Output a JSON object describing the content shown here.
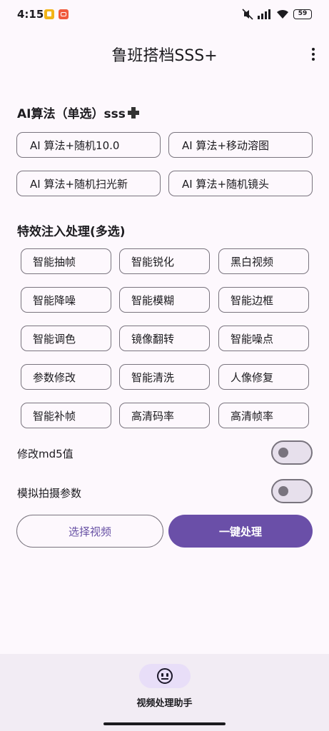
{
  "status": {
    "time": "4:15",
    "battery": "59"
  },
  "app": {
    "title": "鲁班搭档SSS+"
  },
  "algo": {
    "title": "AI算法（单选）sss",
    "items": [
      "AI 算法+随机10.0",
      "AI 算法+移动溶图",
      "AI 算法+随机扫光新",
      "AI 算法+随机镜头"
    ]
  },
  "effects": {
    "title": "特效注入处理(多选)",
    "items": [
      "智能抽帧",
      "智能锐化",
      "黑白视频",
      "智能降噪",
      "智能模糊",
      "智能边框",
      "智能调色",
      "镜像翻转",
      "智能噪点",
      "参数修改",
      "智能清洗",
      "人像修复",
      "智能补帧",
      "高清码率",
      "高清帧率"
    ]
  },
  "switches": [
    {
      "label": "修改md5值",
      "on": false
    },
    {
      "label": "模拟拍摄参数",
      "on": false
    }
  ],
  "actions": {
    "select_video": "选择视频",
    "one_click": "一键处理"
  },
  "nav": {
    "label": "视频处理助手",
    "icon": "face-icon"
  },
  "colors": {
    "primary": "#6a4fa8",
    "outline": "#79747e",
    "background": "#fdf8fd",
    "nav_bg": "#f2ecf4",
    "nav_pill": "#e8def8"
  }
}
